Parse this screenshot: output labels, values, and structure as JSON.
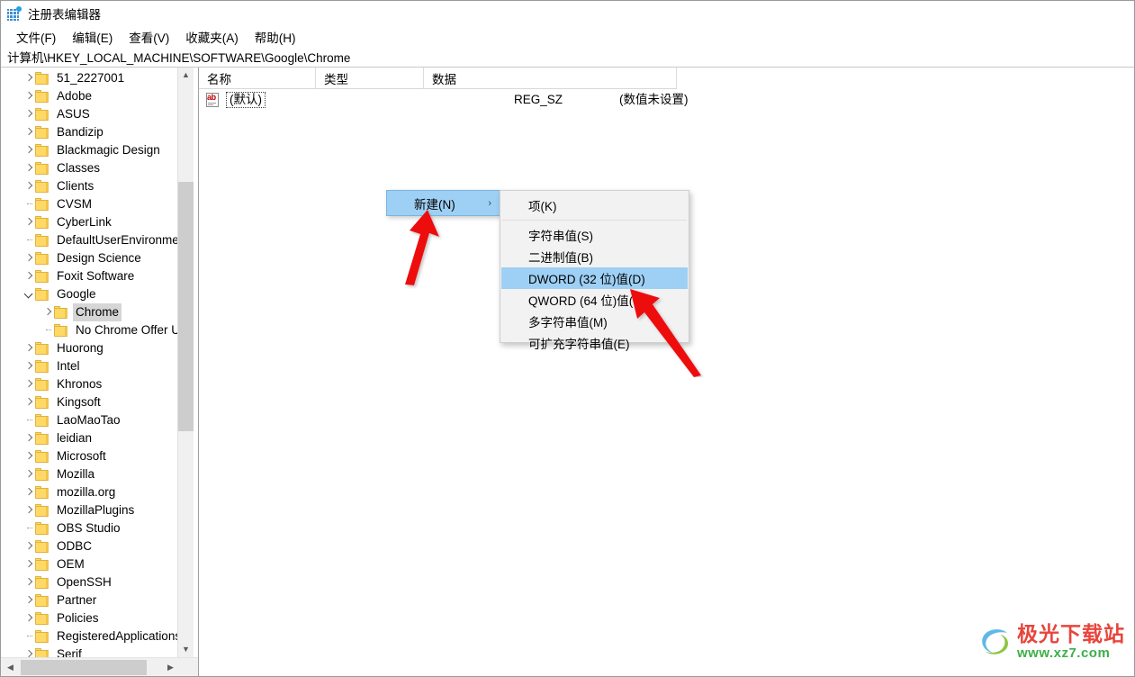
{
  "window": {
    "title": "注册表编辑器",
    "icon": "registry-editor-icon"
  },
  "menubar": {
    "items": [
      {
        "label": "文件(F)",
        "name": "menu-file"
      },
      {
        "label": "编辑(E)",
        "name": "menu-edit"
      },
      {
        "label": "查看(V)",
        "name": "menu-view"
      },
      {
        "label": "收藏夹(A)",
        "name": "menu-favorites"
      },
      {
        "label": "帮助(H)",
        "name": "menu-help"
      }
    ]
  },
  "address": {
    "path": "计算机\\HKEY_LOCAL_MACHINE\\SOFTWARE\\Google\\Chrome"
  },
  "tree": {
    "items": [
      {
        "label": "51_2227001",
        "depth": 1,
        "state": "collapsed",
        "selected": false
      },
      {
        "label": "Adobe",
        "depth": 1,
        "state": "collapsed",
        "selected": false
      },
      {
        "label": "ASUS",
        "depth": 1,
        "state": "collapsed",
        "selected": false
      },
      {
        "label": "Bandizip",
        "depth": 1,
        "state": "collapsed",
        "selected": false
      },
      {
        "label": "Blackmagic Design",
        "depth": 1,
        "state": "collapsed",
        "selected": false
      },
      {
        "label": "Classes",
        "depth": 1,
        "state": "collapsed",
        "selected": false
      },
      {
        "label": "Clients",
        "depth": 1,
        "state": "collapsed",
        "selected": false
      },
      {
        "label": "CVSM",
        "depth": 1,
        "state": "leaf",
        "selected": false
      },
      {
        "label": "CyberLink",
        "depth": 1,
        "state": "collapsed",
        "selected": false
      },
      {
        "label": "DefaultUserEnvironment",
        "depth": 1,
        "state": "leaf",
        "selected": false
      },
      {
        "label": "Design Science",
        "depth": 1,
        "state": "collapsed",
        "selected": false
      },
      {
        "label": "Foxit Software",
        "depth": 1,
        "state": "collapsed",
        "selected": false
      },
      {
        "label": "Google",
        "depth": 1,
        "state": "expanded",
        "selected": false
      },
      {
        "label": "Chrome",
        "depth": 2,
        "state": "collapsed",
        "selected": true
      },
      {
        "label": "No Chrome Offer Until",
        "depth": 2,
        "state": "leaf",
        "selected": false
      },
      {
        "label": "Huorong",
        "depth": 1,
        "state": "collapsed",
        "selected": false
      },
      {
        "label": "Intel",
        "depth": 1,
        "state": "collapsed",
        "selected": false
      },
      {
        "label": "Khronos",
        "depth": 1,
        "state": "collapsed",
        "selected": false
      },
      {
        "label": "Kingsoft",
        "depth": 1,
        "state": "collapsed",
        "selected": false
      },
      {
        "label": "LaoMaoTao",
        "depth": 1,
        "state": "leaf",
        "selected": false
      },
      {
        "label": "leidian",
        "depth": 1,
        "state": "collapsed",
        "selected": false
      },
      {
        "label": "Microsoft",
        "depth": 1,
        "state": "collapsed",
        "selected": false
      },
      {
        "label": "Mozilla",
        "depth": 1,
        "state": "collapsed",
        "selected": false
      },
      {
        "label": "mozilla.org",
        "depth": 1,
        "state": "collapsed",
        "selected": false
      },
      {
        "label": "MozillaPlugins",
        "depth": 1,
        "state": "collapsed",
        "selected": false
      },
      {
        "label": "OBS Studio",
        "depth": 1,
        "state": "leaf",
        "selected": false
      },
      {
        "label": "ODBC",
        "depth": 1,
        "state": "collapsed",
        "selected": false
      },
      {
        "label": "OEM",
        "depth": 1,
        "state": "collapsed",
        "selected": false
      },
      {
        "label": "OpenSSH",
        "depth": 1,
        "state": "collapsed",
        "selected": false
      },
      {
        "label": "Partner",
        "depth": 1,
        "state": "collapsed",
        "selected": false
      },
      {
        "label": "Policies",
        "depth": 1,
        "state": "collapsed",
        "selected": false
      },
      {
        "label": "RegisteredApplications",
        "depth": 1,
        "state": "leaf",
        "selected": false
      },
      {
        "label": "Serif",
        "depth": 1,
        "state": "collapsed",
        "selected": false
      }
    ]
  },
  "list": {
    "columns": [
      {
        "label": "名称",
        "name": "column-name"
      },
      {
        "label": "类型",
        "name": "column-type"
      },
      {
        "label": "数据",
        "name": "column-data"
      }
    ],
    "rows": [
      {
        "name": "(默认)",
        "type": "REG_SZ",
        "data": "(数值未设置)",
        "icon": "string-value-icon"
      }
    ]
  },
  "context_menu": {
    "parent": {
      "label": "新建(N)",
      "submenu_arrow": "›",
      "highlighted": true
    },
    "submenu": [
      {
        "label": "项(K)",
        "highlighted": false,
        "separator_after": true
      },
      {
        "label": "字符串值(S)",
        "highlighted": false,
        "separator_after": false
      },
      {
        "label": "二进制值(B)",
        "highlighted": false,
        "separator_after": false
      },
      {
        "label": "DWORD (32 位)值(D)",
        "highlighted": true,
        "separator_after": false
      },
      {
        "label": "QWORD (64 位)值(Q)",
        "highlighted": false,
        "separator_after": false
      },
      {
        "label": "多字符串值(M)",
        "highlighted": false,
        "separator_after": false
      },
      {
        "label": "可扩充字符串值(E)",
        "highlighted": false,
        "separator_after": false
      }
    ]
  },
  "annotations": {
    "arrow_color": "#ee1111",
    "arrows": [
      {
        "name": "arrow-to-new-menu",
        "points_to": "新建(N)"
      },
      {
        "name": "arrow-to-dword-item",
        "points_to": "DWORD (32 位)值(D)"
      }
    ]
  },
  "watermark": {
    "title": "极光下载站",
    "url": "www.xz7.com",
    "title_color": "#e8453c",
    "url_color": "#3fae49"
  },
  "scrollbars": {
    "tree_vertical": {
      "up_glyph": "︿",
      "down_glyph": "﹀"
    },
    "tree_horizontal": {
      "left_glyph": "‹",
      "right_glyph": "›"
    }
  }
}
